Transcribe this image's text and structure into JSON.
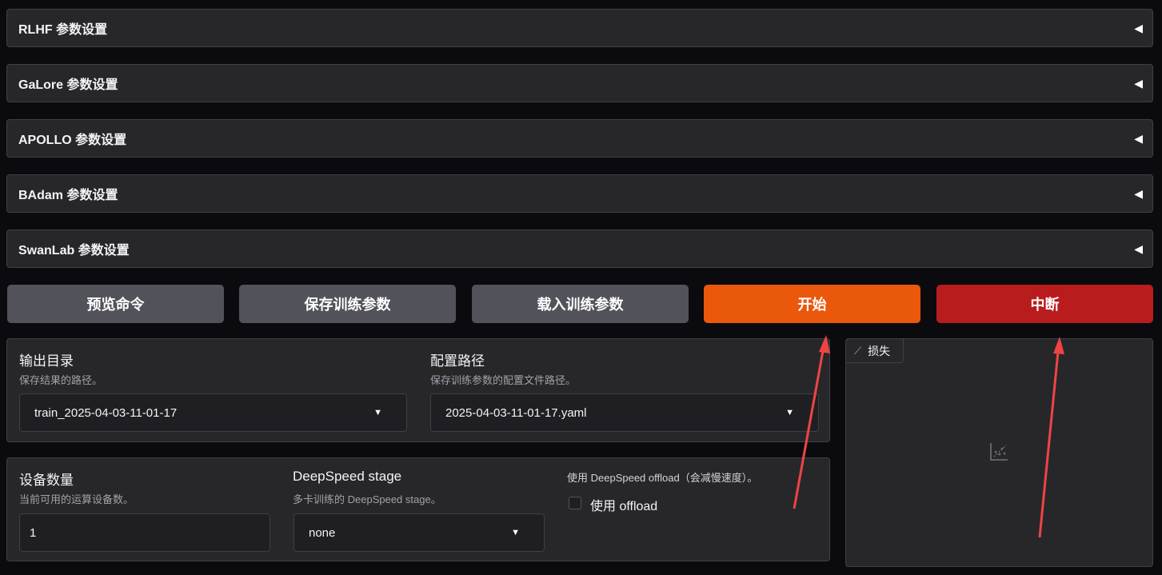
{
  "accordions": [
    {
      "label": "RLHF 参数设置"
    },
    {
      "label": "GaLore 参数设置"
    },
    {
      "label": "APOLLO 参数设置"
    },
    {
      "label": "BAdam 参数设置"
    },
    {
      "label": "SwanLab 参数设置"
    }
  ],
  "actions": {
    "preview": "预览命令",
    "save": "保存训练参数",
    "load": "载入训练参数",
    "start": "开始",
    "abort": "中断"
  },
  "output": {
    "title": "输出目录",
    "info": "保存结果的路径。",
    "value": "train_2025-04-03-11-01-17"
  },
  "config": {
    "title": "配置路径",
    "info": "保存训练参数的配置文件路径。",
    "value": "2025-04-03-11-01-17.yaml"
  },
  "devices": {
    "title": "设备数量",
    "info": "当前可用的运算设备数。",
    "value": "1"
  },
  "deepspeed": {
    "title": "DeepSpeed stage",
    "info": "多卡训练的 DeepSpeed stage。",
    "value": "none"
  },
  "offload": {
    "info": "使用 DeepSpeed offload（会减慢速度）。",
    "label": "使用 offload",
    "checked": false
  },
  "plot": {
    "label": "损失"
  },
  "colors": {
    "start": "#ea580c",
    "abort": "#b91c1c",
    "annotation": "#ef4444"
  }
}
